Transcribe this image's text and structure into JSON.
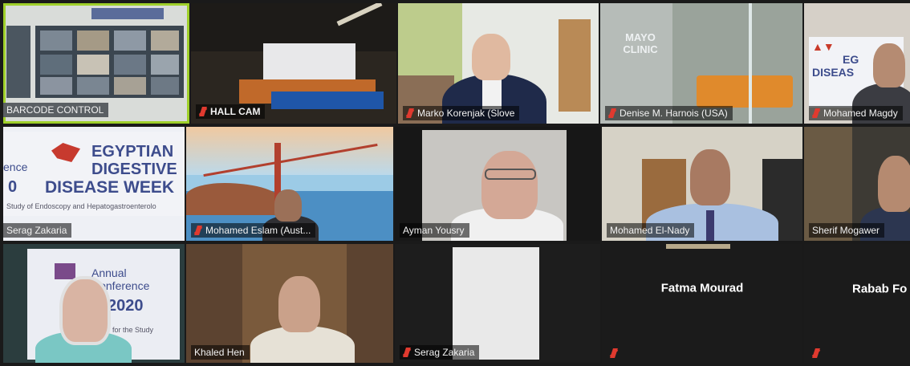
{
  "tiles": {
    "barcode_control": "BARCODE CONTROL",
    "hall_cam": "HALL CAM",
    "marko": "Marko Korenjak (Slove",
    "denise": "Denise M. Harnois (USA)",
    "mohamed_magdy": "Mohamed Magdy",
    "serag_top": "Serag Zakaria",
    "mohamed_eslam": "Mohamed Eslam (Aust...",
    "ayman": "Ayman Yousry",
    "mohamed_elnady": "Mohamed El-Nady",
    "sherif": "Sherif Mogawer",
    "khaled": "Khaled Hen",
    "serag_bottom": "Serag Zakaria",
    "fatma": "Fatma Mourad",
    "rabab": "Rabab Fo"
  },
  "banner": {
    "line1": "EGYPTIAN",
    "line2": "DIGESTIVE",
    "line3": "DISEASE WEEK",
    "prefix": "ence",
    "digit": "0",
    "sub": "Study of Endoscopy and Hepatogastroenterolo",
    "small": "EG",
    "small2": "DISEAS",
    "mayo": "MAYO CLINIC",
    "annual": "Annual",
    "conference": "Conference",
    "year": "2020",
    "society": "Society for the Study"
  },
  "colors": {
    "accent_green": "#9fd02a",
    "muted_red": "#e03a2f",
    "banner_blue": "#3d4c8c"
  }
}
